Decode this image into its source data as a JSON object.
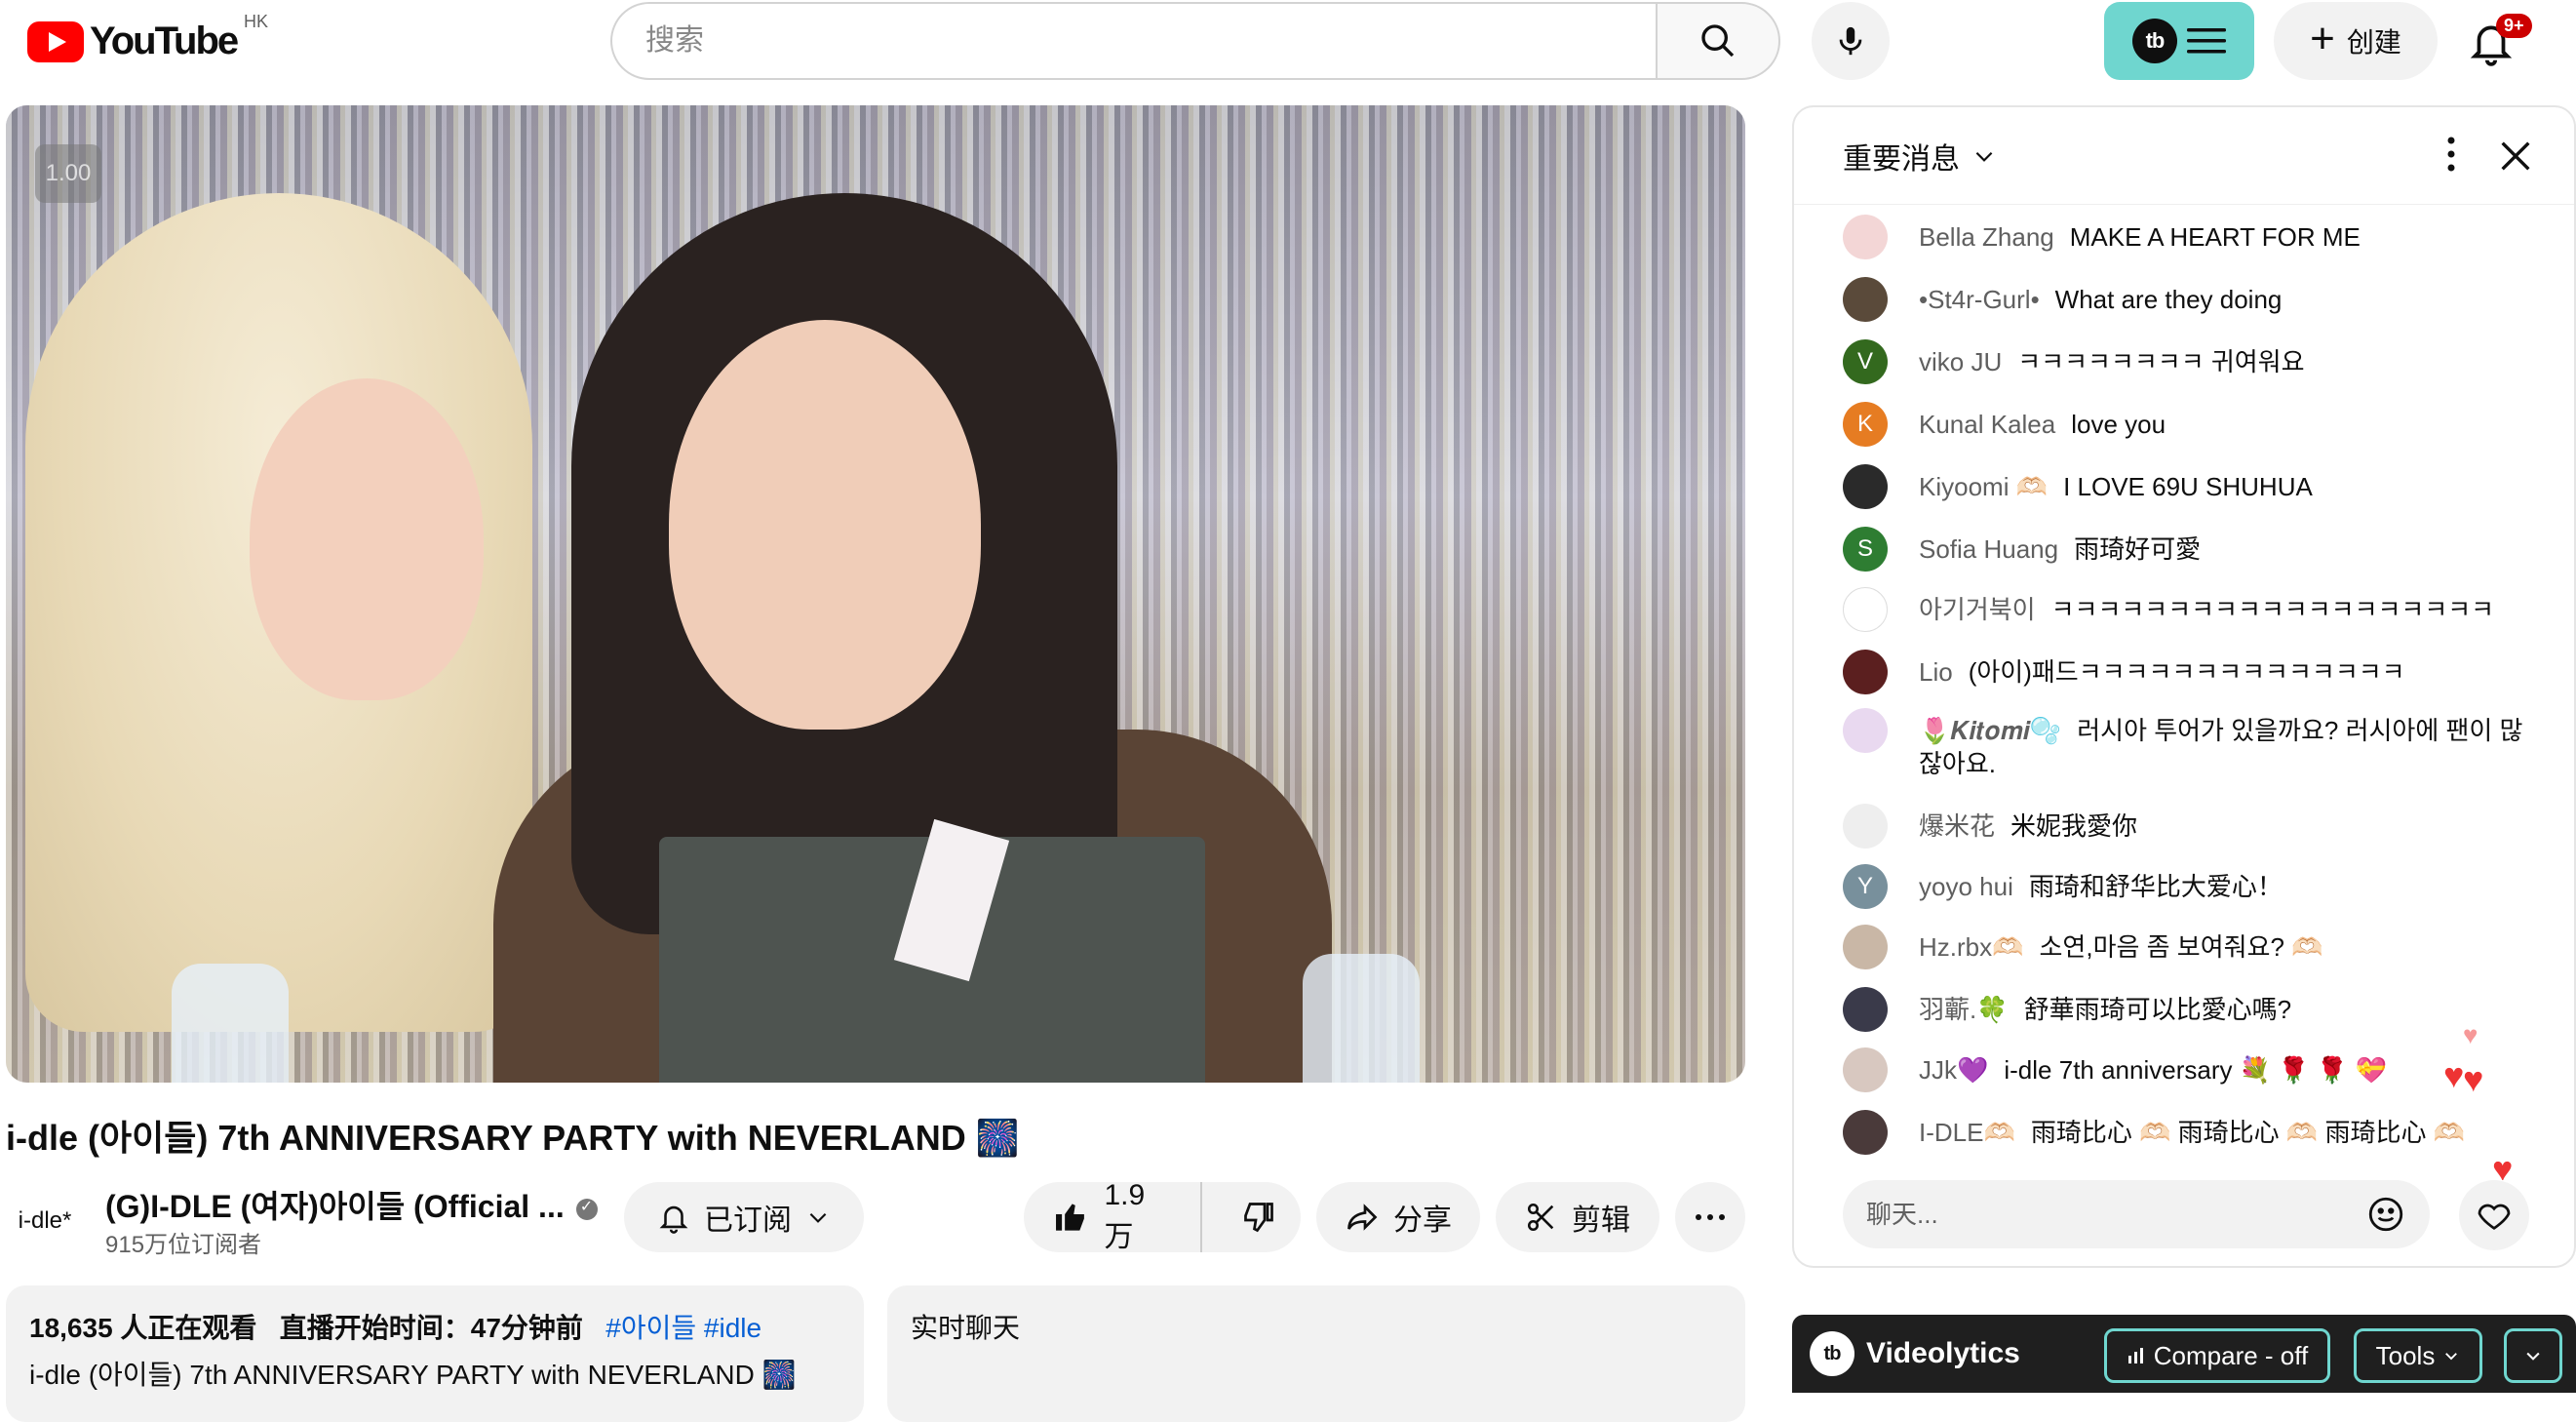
{
  "header": {
    "logo_text": "YouTube",
    "region": "HK",
    "search_placeholder": "搜索",
    "create_label": "创建",
    "notif_count": "9+",
    "tb_logo": "tb"
  },
  "video": {
    "speed_label": "1.00",
    "title": "i-dle (아이들) 7th ANNIVERSARY PARTY with NEVERLAND 🎆",
    "channel_avatar_text": "i-dle*",
    "channel_name": "(G)I-DLE (여자)아이들 (Official ...",
    "subscribers": "915万位订阅者",
    "subscribed_label": "已订阅",
    "likes": "1.9万",
    "share_label": "分享",
    "clip_label": "剪辑"
  },
  "description": {
    "viewers": "18,635 人正在观看",
    "started": "直播开始时间：47分钟前",
    "tags": [
      "#아이들",
      "#idle"
    ],
    "line2": "i-dle (아이들) 7th ANNIVERSARY PARTY with NEVERLAND 🎆"
  },
  "chat_replay_label": "实时聊天",
  "chat": {
    "header_title": "重要消息",
    "input_placeholder": "聊天...",
    "messages": [
      {
        "author": "Bella Zhang",
        "text": "MAKE A HEART FOR ME",
        "avatar_color": "#f3d6d6",
        "avatar_letter": ""
      },
      {
        "author": "•St4r-Gurl•",
        "text": "What are they doing",
        "avatar_color": "#5a4a3a",
        "avatar_letter": ""
      },
      {
        "author": "viko JU",
        "text": "ㅋㅋㅋㅋㅋㅋㅋㅋ 귀여워요",
        "avatar_color": "#33691e",
        "avatar_letter": "V"
      },
      {
        "author": "Kunal Kalea",
        "text": "love you",
        "avatar_color": "#e67c22",
        "avatar_letter": "K"
      },
      {
        "author": "Kiyoomi 🫶🏻",
        "text": "I LOVE 69U SHUHUA",
        "avatar_color": "#2a2a2a",
        "avatar_letter": ""
      },
      {
        "author": "Sofia Huang",
        "text": "雨琦好可愛",
        "avatar_color": "#2e7d32",
        "avatar_letter": "S"
      },
      {
        "author": "아기거북이",
        "text": "ㅋㅋㅋㅋㅋㅋㅋㅋㅋㅋㅋㅋㅋㅋㅋㅋㅋㅋㅋ",
        "avatar_color": "#ffffff",
        "avatar_letter": ""
      },
      {
        "author": "Lio",
        "text": "(아이)패드ㅋㅋㅋㅋㅋㅋㅋㅋㅋㅋㅋㅋㅋㅋ",
        "avatar_color": "#5b1f1f",
        "avatar_letter": ""
      },
      {
        "author": "🌷𝑲𝒊𝒕𝒐𝒎𝒊🫧",
        "text": "러시아 투어가 있을까요? 러시아에 팬이 많잖아요.",
        "avatar_color": "#e9d9f0",
        "avatar_letter": ""
      },
      {
        "author": "爆米花",
        "text": "米妮我愛你",
        "avatar_color": "#eeeeee",
        "avatar_letter": ""
      },
      {
        "author": "yoyo hui",
        "text": "雨琦和舒华比大爱心！",
        "avatar_color": "#78909c",
        "avatar_letter": "Y"
      },
      {
        "author": "Hz.rbx🫶🏻",
        "text": "소연,마음 좀 보여줘요? 🫶🏻",
        "avatar_color": "#c9b7a6",
        "avatar_letter": ""
      },
      {
        "author": "羽蘄.🍀",
        "text": "舒華雨琦可以比愛心嗎?",
        "avatar_color": "#3a3a4a",
        "avatar_letter": ""
      },
      {
        "author": "JJk💜",
        "text": "i-dle 7th anniversary 💐 🌹 🌹 💝",
        "avatar_color": "#d8c8c0",
        "avatar_letter": ""
      },
      {
        "author": "I-DLE🫶🏻",
        "text": "雨琦比心 🫶🏻 雨琦比心 🫶🏻 雨琦比心 🫶🏻",
        "avatar_color": "#4a3a3a",
        "avatar_letter": ""
      }
    ]
  },
  "videolytics": {
    "name": "Videolytics",
    "logo": "tb",
    "compare_label": "Compare - off",
    "tools_label": "Tools"
  }
}
